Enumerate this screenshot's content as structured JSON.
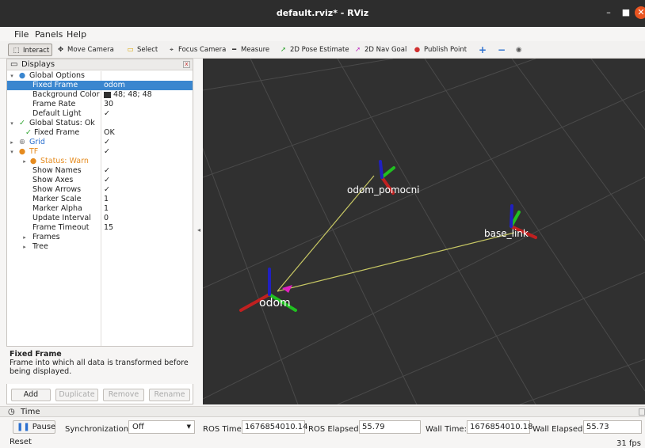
{
  "window": {
    "title": "default.rviz* - RViz",
    "min": "–",
    "max": "■",
    "close": "✕"
  },
  "menu": {
    "file": "File",
    "panels": "Panels",
    "help": "Help"
  },
  "toolbar": {
    "interact": "Interact",
    "move_camera": "Move Camera",
    "select": "Select",
    "focus_camera": "Focus Camera",
    "measure": "Measure",
    "pose_estimate": "2D Pose Estimate",
    "nav_goal": "2D Nav Goal",
    "publish_point": "Publish Point",
    "add_tool": "+",
    "remove_tool": "−",
    "camera_type": "◉"
  },
  "displays": {
    "title": "Displays",
    "rows": [
      {
        "label": "Global Options",
        "value": ""
      },
      {
        "label": "Fixed Frame",
        "value": "odom"
      },
      {
        "label": "Background Color",
        "value": "48; 48; 48"
      },
      {
        "label": "Frame Rate",
        "value": "30"
      },
      {
        "label": "Default Light",
        "value": "✓"
      },
      {
        "label": "Global Status: Ok",
        "value": ""
      },
      {
        "label": "Fixed Frame",
        "value": "OK"
      },
      {
        "label": "Grid",
        "value": "✓"
      },
      {
        "label": "TF",
        "value": "✓"
      },
      {
        "label": "Status: Warn",
        "value": ""
      },
      {
        "label": "Show Names",
        "value": "✓"
      },
      {
        "label": "Show Axes",
        "value": "✓"
      },
      {
        "label": "Show Arrows",
        "value": "✓"
      },
      {
        "label": "Marker Scale",
        "value": "1"
      },
      {
        "label": "Marker Alpha",
        "value": "1"
      },
      {
        "label": "Update Interval",
        "value": "0"
      },
      {
        "label": "Frame Timeout",
        "value": "15"
      },
      {
        "label": "Frames",
        "value": ""
      },
      {
        "label": "Tree",
        "value": ""
      }
    ],
    "desc_title": "Fixed Frame",
    "desc_text": "Frame into which all data is transformed before being displayed.",
    "buttons": {
      "add": "Add",
      "duplicate": "Duplicate",
      "remove": "Remove",
      "rename": "Rename"
    }
  },
  "scene": {
    "frame_odom": "odom",
    "frame_pomocni": "odom_pomocni",
    "frame_base": "base_link"
  },
  "time": {
    "title": "Time",
    "pause": "Pause",
    "sync_label": "Synchronization:",
    "sync_value": "Off",
    "ros_time_label": "ROS Time:",
    "ros_time": "1676854010.14",
    "ros_elapsed_label": "ROS Elapsed:",
    "ros_elapsed": "55.79",
    "wall_time_label": "Wall Time:",
    "wall_time": "1676854010.18",
    "wall_elapsed_label": "Wall Elapsed:",
    "wall_elapsed": "55.73",
    "reset": "Reset",
    "fps": "31 fps"
  },
  "colors": {
    "selection": "#3a86cf",
    "viewport_bg": "#303030",
    "accent_orange": "#e95420"
  }
}
